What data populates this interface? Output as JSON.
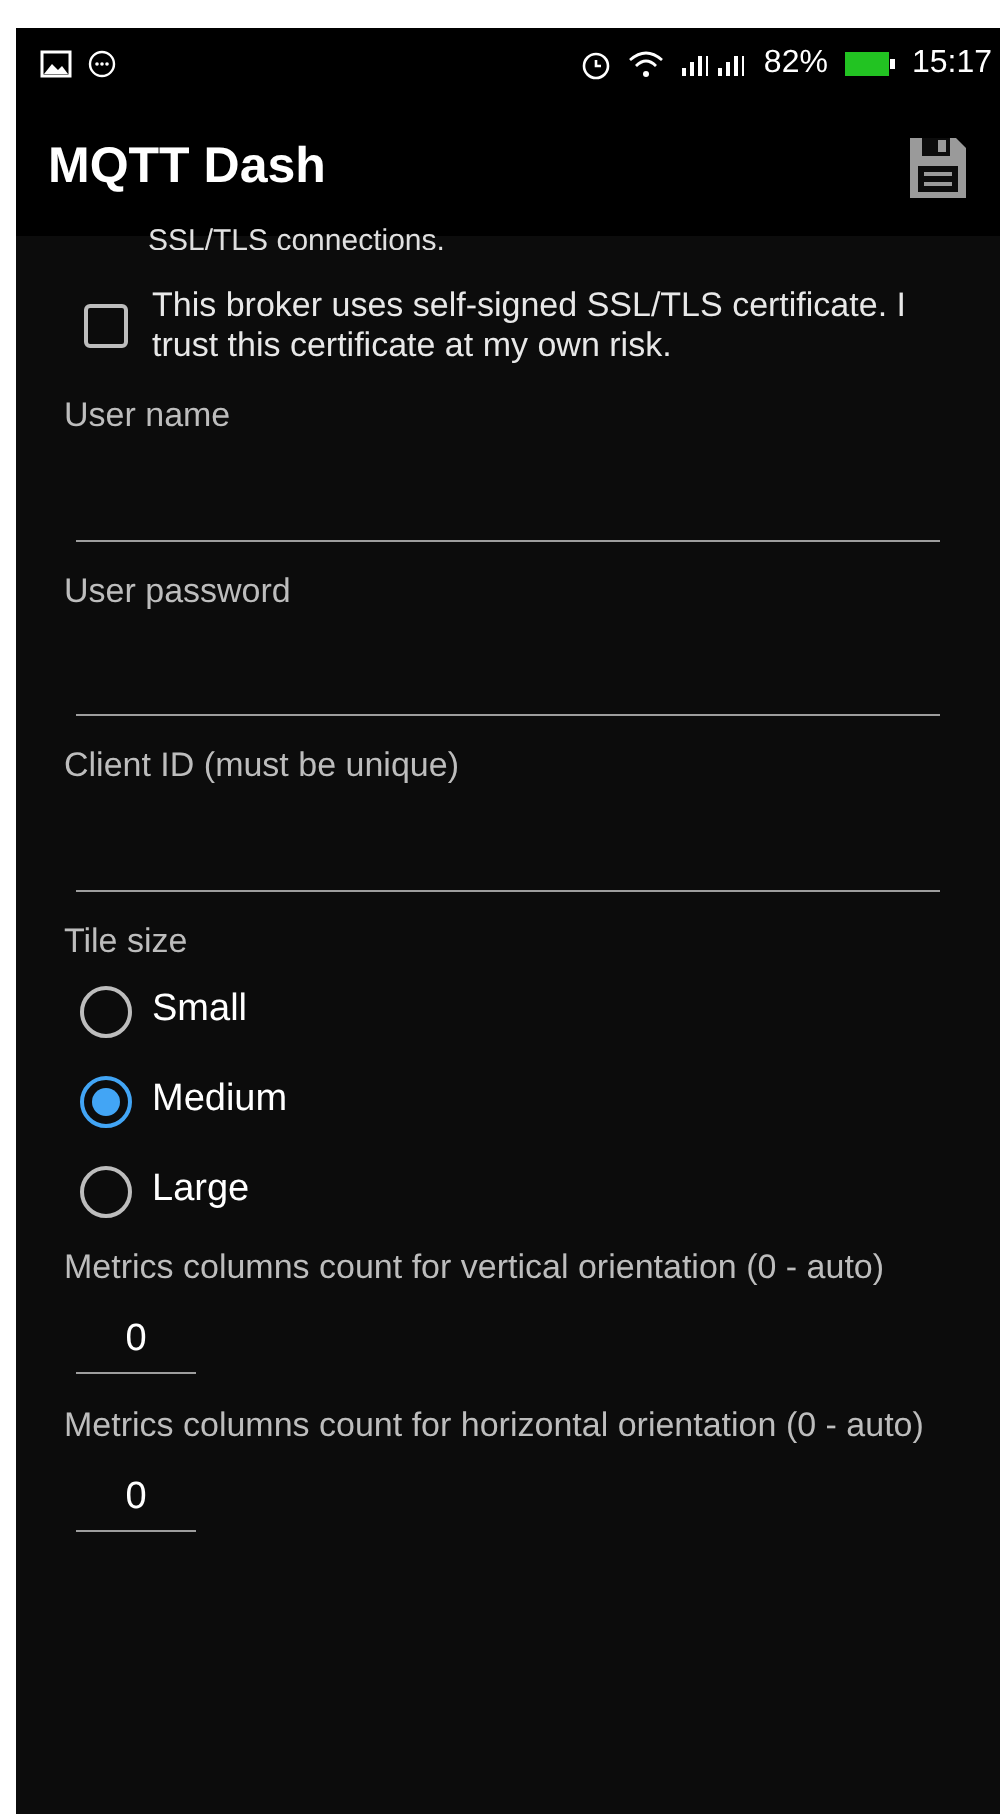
{
  "status_bar": {
    "battery": "82%",
    "time": "15:17"
  },
  "app_bar": {
    "title": "MQTT Dash"
  },
  "partial_text": "SSL/TLS connections.",
  "self_signed": {
    "label": "This broker uses self-signed SSL/TLS certificate. I trust this certificate at my own risk.",
    "checked": false
  },
  "fields": [
    {
      "label": "User name"
    },
    {
      "label": "User password"
    },
    {
      "label": "Client ID (must be unique)"
    }
  ],
  "tile_size": {
    "label": "Tile size",
    "options": [
      {
        "label": "Small",
        "selected": false
      },
      {
        "label": "Medium",
        "selected": true
      },
      {
        "label": "Large",
        "selected": false
      }
    ]
  },
  "columns": [
    {
      "label": "Metrics columns count for vertical orientation (0 - auto)",
      "value": "0"
    },
    {
      "label": "Metrics columns count for horizontal orientation (0 - auto)",
      "value": "0"
    }
  ]
}
